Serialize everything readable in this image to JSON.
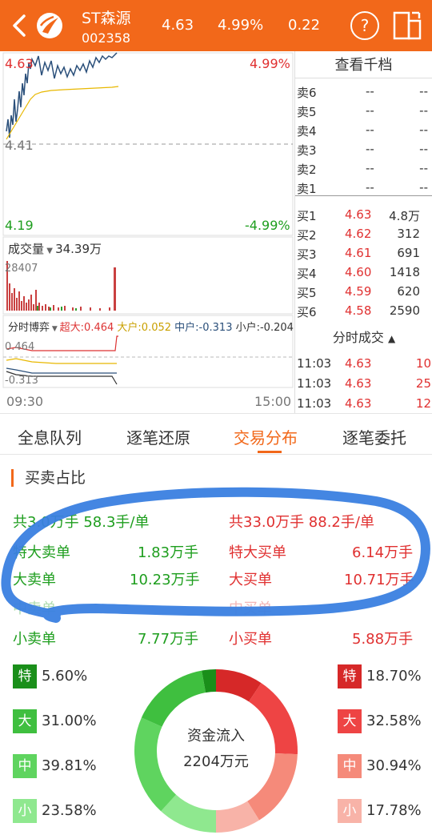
{
  "header": {
    "stock_name": "ST森源",
    "stock_code": "002358",
    "price": "4.63",
    "change_pct": "4.99%",
    "change_amt": "0.22",
    "help_label": "?",
    "colors": {
      "bar": "#f2681a",
      "up": "#e03030",
      "down": "#1e9e1e"
    }
  },
  "chart": {
    "high_price": "4.63",
    "high_pct": "4.99%",
    "mid_price": "4.41",
    "low_price": "4.19",
    "low_pct": "-4.99%",
    "volume_label": "成交量",
    "volume_value": "34.39万",
    "volume_max": "28407",
    "game_label": "分时博弈",
    "game_big": "超大:0.464",
    "game_large": "大户:0.052",
    "game_mid": "中户:-0.313",
    "game_small": "小户:-0.204",
    "game_top": "0.464",
    "game_bottom": "-0.313",
    "time_start": "09:30",
    "time_end": "15:00"
  },
  "order_book": {
    "title": "查看千档",
    "sells": [
      {
        "label": "卖6",
        "price": "--",
        "vol": "--"
      },
      {
        "label": "卖5",
        "price": "--",
        "vol": "--"
      },
      {
        "label": "卖4",
        "price": "--",
        "vol": "--"
      },
      {
        "label": "卖3",
        "price": "--",
        "vol": "--"
      },
      {
        "label": "卖2",
        "price": "--",
        "vol": "--"
      },
      {
        "label": "卖1",
        "price": "--",
        "vol": "--"
      }
    ],
    "buys": [
      {
        "label": "买1",
        "price": "4.63",
        "vol": "4.8万"
      },
      {
        "label": "买2",
        "price": "4.62",
        "vol": "312"
      },
      {
        "label": "买3",
        "price": "4.61",
        "vol": "691"
      },
      {
        "label": "买4",
        "price": "4.60",
        "vol": "1418"
      },
      {
        "label": "买5",
        "price": "4.59",
        "vol": "620"
      },
      {
        "label": "买6",
        "price": "4.58",
        "vol": "2590"
      }
    ],
    "trades_title": "分时成交",
    "trades": [
      {
        "time": "11:03",
        "price": "4.63",
        "vol": "10"
      },
      {
        "time": "11:03",
        "price": "4.63",
        "vol": "25"
      },
      {
        "time": "11:03",
        "price": "4.63",
        "vol": "12"
      }
    ]
  },
  "tabs": [
    "全息队列",
    "逐笔还原",
    "交易分布",
    "逐笔委托"
  ],
  "active_tab": "交易分布",
  "section": {
    "title": "买卖占比"
  },
  "distribution": {
    "sell_total": "共3.0万手 58.3手/单",
    "buy_total": "共33.0万手 88.2手/单",
    "rows": [
      {
        "sell_label": "特大卖单",
        "sell_val": "1.83万手",
        "buy_label": "特大买单",
        "buy_val": "6.14万手"
      },
      {
        "sell_label": "大卖单",
        "sell_val": "10.23万手",
        "buy_label": "大买单",
        "buy_val": "10.71万手"
      },
      {
        "sell_label": "中卖单",
        "sell_val": "",
        "buy_label": "中买单",
        "buy_val": ""
      },
      {
        "sell_label": "小卖单",
        "sell_val": "7.77万手",
        "buy_label": "小买单",
        "buy_val": "5.88万手"
      }
    ]
  },
  "ratios": {
    "sell": [
      {
        "badge": "特",
        "pct": "5.60%",
        "value": 5.6,
        "color": "#1a8f1a"
      },
      {
        "badge": "大",
        "pct": "31.00%",
        "value": 31.0,
        "color": "#3fbf3f"
      },
      {
        "badge": "中",
        "pct": "39.81%",
        "value": 39.81,
        "color": "#5fd45f"
      },
      {
        "badge": "小",
        "pct": "23.58%",
        "value": 23.58,
        "color": "#8fe88f"
      }
    ],
    "buy": [
      {
        "badge": "特",
        "pct": "18.70%",
        "value": 18.7,
        "color": "#d62828"
      },
      {
        "badge": "大",
        "pct": "32.58%",
        "value": 32.58,
        "color": "#ee4444"
      },
      {
        "badge": "中",
        "pct": "30.94%",
        "value": 30.94,
        "color": "#f58a7a"
      },
      {
        "badge": "小",
        "pct": "17.78%",
        "value": 17.78,
        "color": "#f8b3a8"
      }
    ]
  },
  "donut": {
    "label": "资金流入",
    "value": "2204万元"
  }
}
